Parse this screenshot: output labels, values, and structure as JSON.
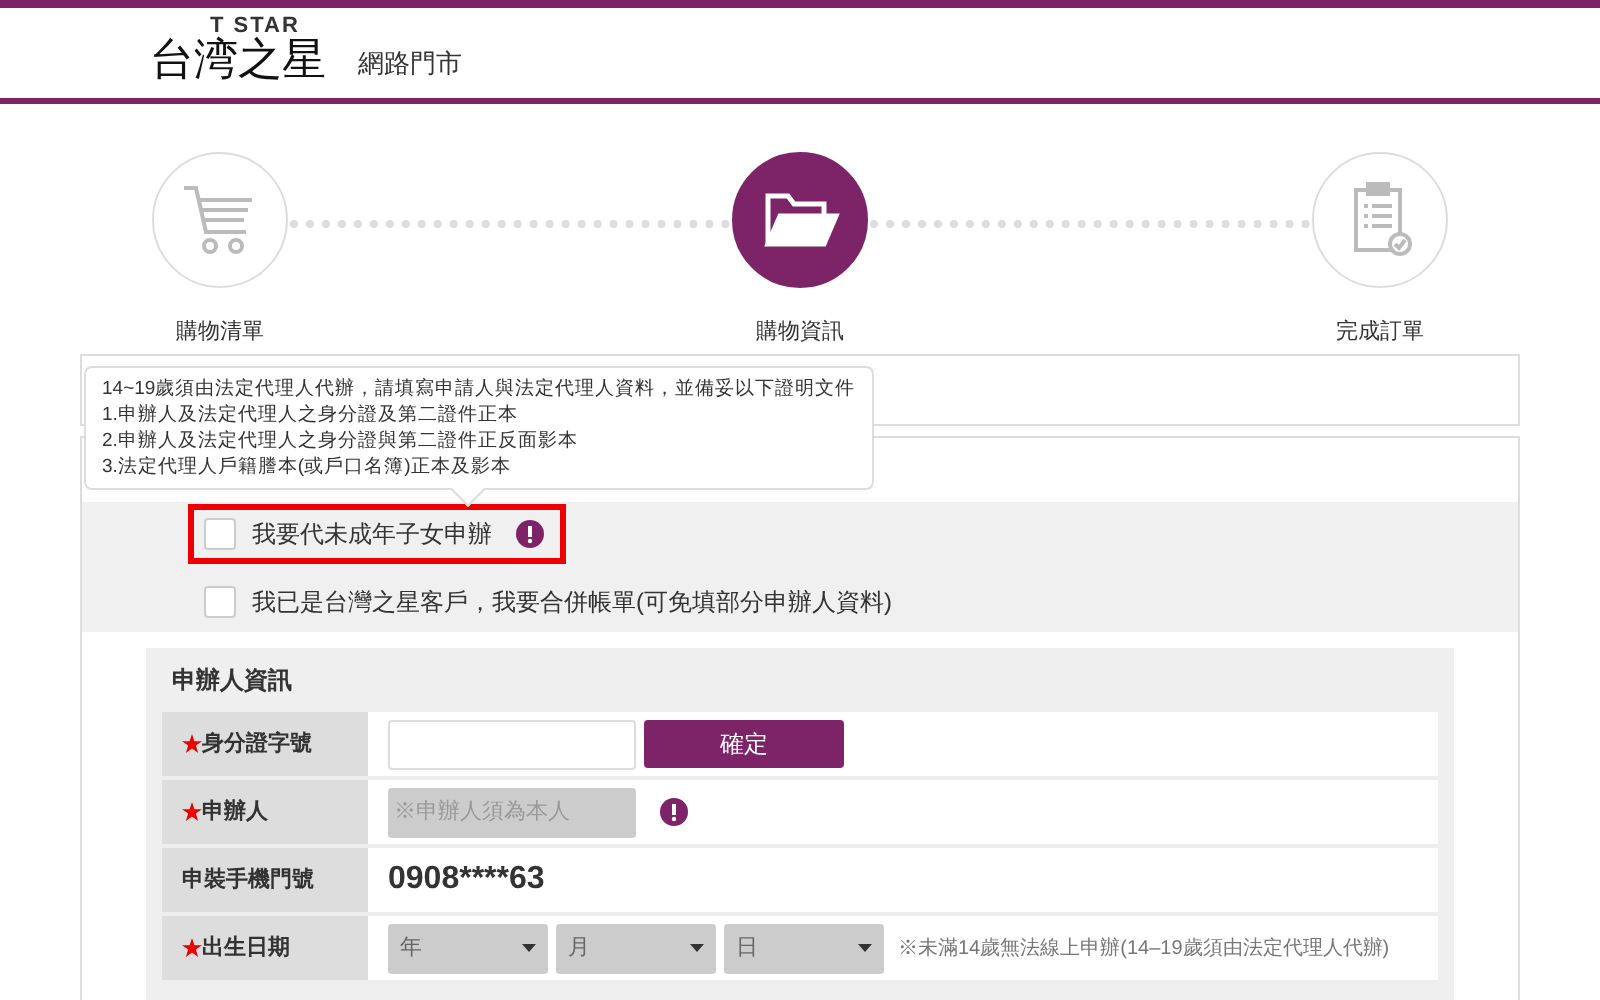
{
  "header": {
    "brand_top": "T STAR",
    "brand": "台湾之星",
    "subtitle": "網路門市"
  },
  "steps": [
    {
      "label": "購物清單",
      "kind": "cart",
      "selected": false
    },
    {
      "label": "購物資訊",
      "kind": "folder",
      "selected": true
    },
    {
      "label": "完成訂單",
      "kind": "clipboard",
      "selected": false
    }
  ],
  "tooltip": {
    "lines": [
      "14~19歲須由法定代理人代辦，請填寫申請人與法定代理人資料，並備妥以下證明文件",
      "1.申辦人及法定代理人之身分證及第二證件正本",
      "2.申辦人及法定代理人之身分證與第二證件正反面影本",
      "3.法定代理人戶籍謄本(或戶口名簿)正本及影本"
    ]
  },
  "options": [
    {
      "label": "我要代未成年子女申辦",
      "checked": false,
      "highlighted": true,
      "info": true
    },
    {
      "label": "我已是台灣之星客戶，我要合併帳單(可免填部分申辦人資料)",
      "checked": false,
      "highlighted": false,
      "info": false
    }
  ],
  "applicant": {
    "title": "申辦人資訊",
    "rows": [
      {
        "kind": "input_button",
        "label": "身分證字號",
        "required": true,
        "button": "確定"
      },
      {
        "kind": "input_info",
        "label": "申辦人",
        "required": true,
        "placeholder": "※申辦人須為本人",
        "disabled": true
      },
      {
        "kind": "text",
        "label": "申裝手機門號",
        "required": false,
        "value": "0908****63"
      },
      {
        "kind": "date",
        "label": "出生日期",
        "required": true,
        "selects": [
          "年",
          "月",
          "日"
        ],
        "note": "※未滿14歲無法線上申辦(14–19歲須由法定代理人代辦)"
      }
    ]
  }
}
